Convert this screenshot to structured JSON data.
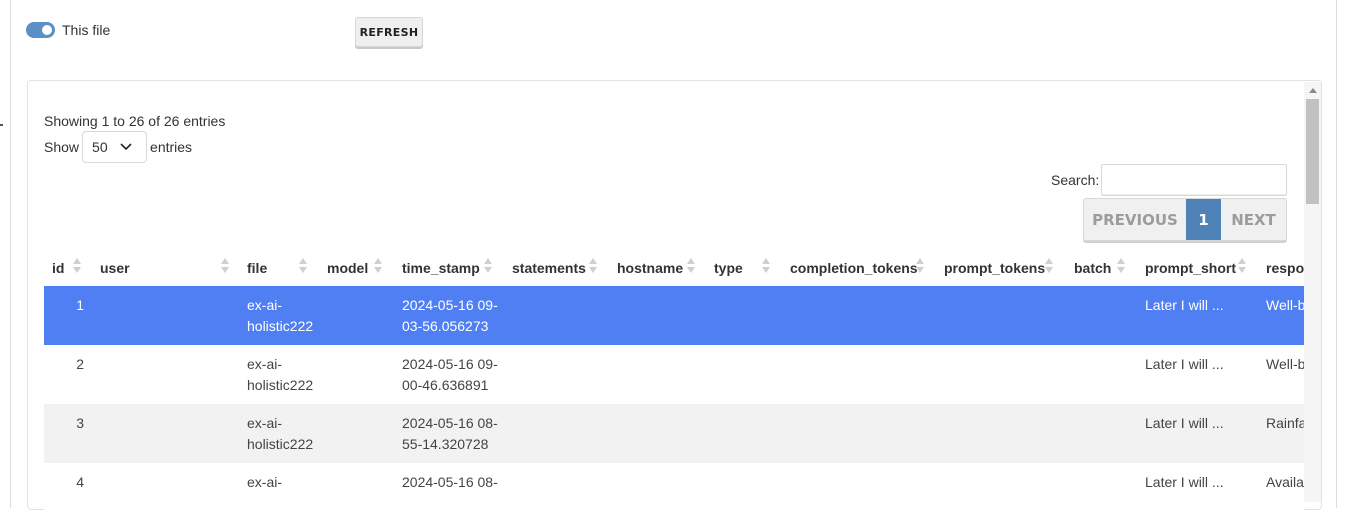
{
  "toggle": {
    "label": "This file",
    "on": true
  },
  "refresh_button": "REFRESH",
  "table_info": "Showing 1 to 26 of 26 entries",
  "length": {
    "prefix": "Show",
    "value": "50",
    "suffix": "entries"
  },
  "search": {
    "label": "Search:",
    "value": ""
  },
  "pagination": {
    "previous": "PREVIOUS",
    "current": "1",
    "next": "NEXT"
  },
  "colors": {
    "selected_row": "#4f7ff2",
    "accent": "#4f83b8",
    "toggle": "#5b8fc7"
  },
  "columns": [
    "id",
    "user",
    "file",
    "model",
    "time_stamp",
    "statements",
    "hostname",
    "type",
    "completion_tokens",
    "prompt_tokens",
    "batch",
    "prompt_short",
    "respon"
  ],
  "rows": [
    {
      "id": "1",
      "file_1": "ex-ai-",
      "file_2": "holistic222",
      "ts_1": "2024-05-16 09-",
      "ts_2": "03-56.056273",
      "prompt_short": "Later I will ...",
      "response": "Well-b"
    },
    {
      "id": "2",
      "file_1": "ex-ai-",
      "file_2": "holistic222",
      "ts_1": "2024-05-16 09-",
      "ts_2": "00-46.636891",
      "prompt_short": "Later I will ...",
      "response": "Well-b"
    },
    {
      "id": "3",
      "file_1": "ex-ai-",
      "file_2": "holistic222",
      "ts_1": "2024-05-16 08-",
      "ts_2": "55-14.320728",
      "prompt_short": "Later I will ...",
      "response": "Rainfa"
    },
    {
      "id": "4",
      "file_1": "ex-ai-",
      "file_2": "",
      "ts_1": "2024-05-16 08-",
      "ts_2": "",
      "prompt_short": "Later I will ...",
      "response": "Availa"
    }
  ]
}
